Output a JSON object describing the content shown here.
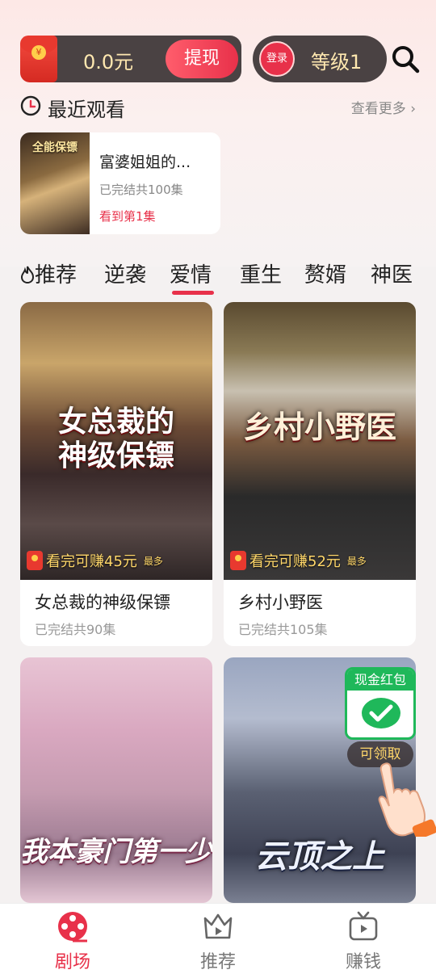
{
  "header": {
    "balance": "0.0元",
    "withdraw_label": "提现",
    "login_label": "登录",
    "level_label": "等级1"
  },
  "recent": {
    "title": "最近观看",
    "more_label": "查看更多",
    "item": {
      "poster_text": "全能保镖",
      "title": "富婆姐姐的...",
      "status": "已完结共100集",
      "progress": "看到第1集"
    }
  },
  "tabs": {
    "items": [
      "推荐",
      "逆袭",
      "爱情",
      "重生",
      "赘婿",
      "神医"
    ],
    "active_index": 2
  },
  "grid": [
    {
      "cover_title": "女总裁的神级保镖",
      "earn": "看完可赚45元",
      "earn_suffix": "最多",
      "title": "女总裁的神级保镖",
      "status": "已完结共90集"
    },
    {
      "cover_title": "乡村小野医",
      "earn": "看完可赚52元",
      "earn_suffix": "最多",
      "title": "乡村小野医",
      "status": "已完结共105集"
    },
    {
      "cover_title": "我本豪门第一少",
      "earn": "",
      "earn_suffix": "",
      "title": "",
      "status": ""
    },
    {
      "cover_title": "云顶之上",
      "earn": "",
      "earn_suffix": "",
      "title": "",
      "status": ""
    }
  ],
  "cash_widget": {
    "title": "现金红包",
    "claim_label": "可领取",
    "icon": "wechat-pay-icon"
  },
  "bottom_nav": {
    "items": [
      {
        "label": "剧场",
        "icon": "film-reel-icon"
      },
      {
        "label": "推荐",
        "icon": "crown-play-icon"
      },
      {
        "label": "赚钱",
        "icon": "tv-play-icon"
      }
    ],
    "active_index": 0
  },
  "colors": {
    "accent": "#e8314a",
    "pill_dark": "#4a4243",
    "gold_text": "#ffe8b0",
    "cash_green": "#1fb85a"
  }
}
